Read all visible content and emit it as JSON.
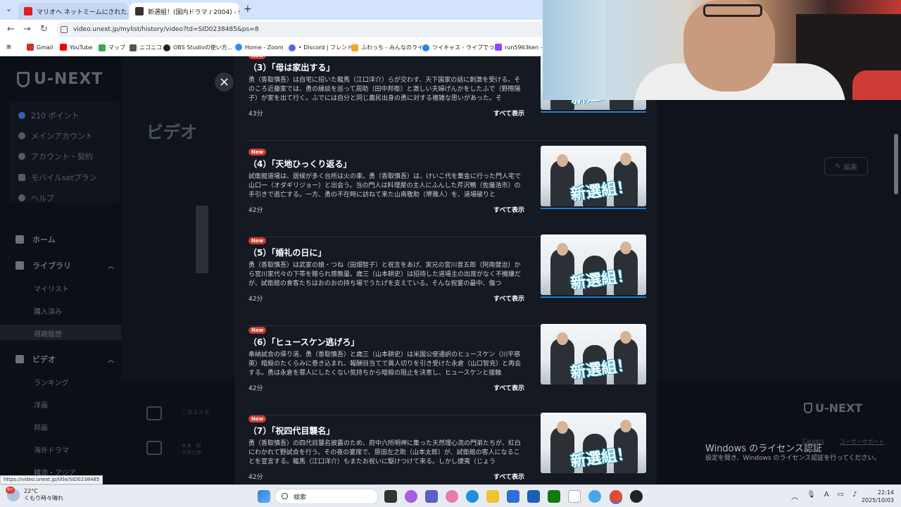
{
  "browser": {
    "tabs": [
      {
        "title": "マリオヘ ネットミームにされた人達に",
        "favicon_color": "#e02020"
      },
      {
        "title": "新選組！(国内ドラマ / 2004) - 動",
        "favicon_color": "#333333"
      }
    ],
    "new_tab": "+",
    "url": "video.unext.jp/mylist/history/video?td=SID0238485&ps=8",
    "bookmarks": [
      {
        "label": "Gmail",
        "color": "#d93025"
      },
      {
        "label": "YouTube",
        "color": "#ff0000"
      },
      {
        "label": "マップ",
        "color": "#34a853"
      },
      {
        "label": "ニコニコ",
        "color": "#555555"
      },
      {
        "label": "OBS Studioの使い方...",
        "color": "#222222"
      },
      {
        "label": "Home - Zoom",
        "color": "#2d8cff"
      },
      {
        "label": "• Discord | フレンド",
        "color": "#5865f2"
      },
      {
        "label": "ふわっち - みんなのライ...",
        "color": "#f5a623"
      },
      {
        "label": "ツイキャス - ライブでつ...",
        "color": "#1e88e5"
      },
      {
        "label": "run5963ken - T",
        "color": "#9146ff"
      }
    ]
  },
  "sidebar": {
    "logo": "U-NEXT",
    "account_items": [
      {
        "label": "210 ポイント"
      },
      {
        "label": "メインアカウント"
      },
      {
        "label": "アカウント・契約"
      },
      {
        "label": "モバイルsetプラン"
      },
      {
        "label": "ヘルプ"
      }
    ],
    "home": "ホーム",
    "library": "ライブラリ",
    "library_items": [
      "マイリスト",
      "購入済み",
      "視聴履歴"
    ],
    "video": "ビデオ",
    "video_items": [
      "ランキング",
      "洋画",
      "邦画",
      "海外ドラマ",
      "韓流・アジア"
    ]
  },
  "page": {
    "title": "ビデオ",
    "edit_label": "編集",
    "behind_text1": "このエルモ",
    "behind_text2": "木米 · 郎\n子供の学",
    "footer_logo": "U-NEXT",
    "footer_links": [
      "Careers",
      "ユーザーサポート"
    ]
  },
  "modal": {
    "close_icon": "×",
    "new_badge": "New",
    "show_all": "すべて表示",
    "episodes": [
      {
        "title": "（3）「母は家出する」",
        "desc": "勇（香取慎吾）は自宅に招いた龍馬（江口洋介）らが交わす、天下国家の話に刺激を受ける。そのころ近藤家では、勇の縁談を巡って周助（田中邦衛）と激しい夫婦げんかをしたふで（野際陽子）が家を出て行く。ふでには自分と同じ農民出身の勇に対する複雑な思いがあった。そ",
        "duration": "43分"
      },
      {
        "title": "（4）「天地ひっくり返る」",
        "desc": "試衛館道場は、居候が多く台所は火の車。勇（香取慎吾）は、けいこ代を集金に行った門人宅で山口一（オダギリジョー）と出会う。当の門人は料理屋の主人にふんした芹沢鴨（佐藤浩市）の手引きで逃亡する。一方、勇の不在時に訪ねて来た山南敬助（堺雅人）を、道場破りと",
        "duration": "42分"
      },
      {
        "title": "（5）「婚礼の日に」",
        "desc": "勇（香取慎吾）は武家の娘・つね（田畑智子）と祝言をあげ、実兄の宮川音五郎（阿南健治）から宮川家代々の下帯を贈られ感無量。歳三（山本耕史）は招待した道場主の出席がなく不機嫌だが、試衛館の食客たちはおのおの持ち場でうたげを支えている。そんな祝宴の最中、傷つ",
        "duration": "42分"
      },
      {
        "title": "（6）「ヒュースケン逃げろ」",
        "desc": "奉納試合の帰り道、勇（香取慎吾）と歳三（山本耕史）は米国公使通訳のヒュースケン（川平慈英）暗殺のたくらみに巻き込まれ、報酬目当てで異人切りを引き受けた永倉（山口智充）と再会する。勇は永倉を罪人にしたくない気持ちから暗殺の阻止を決意し、ヒュースケンと接触",
        "duration": "42分"
      },
      {
        "title": "（7）「祝四代目襲名」",
        "desc": "勇（香取慎吾）の四代目襲名披露のため、府中六所明神に集った天然理心流の門弟たちが、紅白にわかれて野試合を行う。その夜の宴席で、原田左之助（山本太郎）が、試衛館の客人になることを宣言する。龍馬（江口洋介）もまたお祝いに駆けつけて来る。しかし捷夷（じょう",
        "duration": "42分"
      }
    ],
    "thumb_logo": "新選組！"
  },
  "windows": {
    "activation_title": "Windows のライセンス認証",
    "activation_sub": "設定を開き、Windows のライセンス認証を行ってください。"
  },
  "status_url": "https://video.unext.jp/title/SID0238485",
  "taskbar": {
    "weather_temp": "22°C",
    "weather_desc": "くもり時々晴れ",
    "weather_badge": "9+",
    "search_placeholder": "検索",
    "time": "22:14",
    "date": "2025/10/03"
  }
}
